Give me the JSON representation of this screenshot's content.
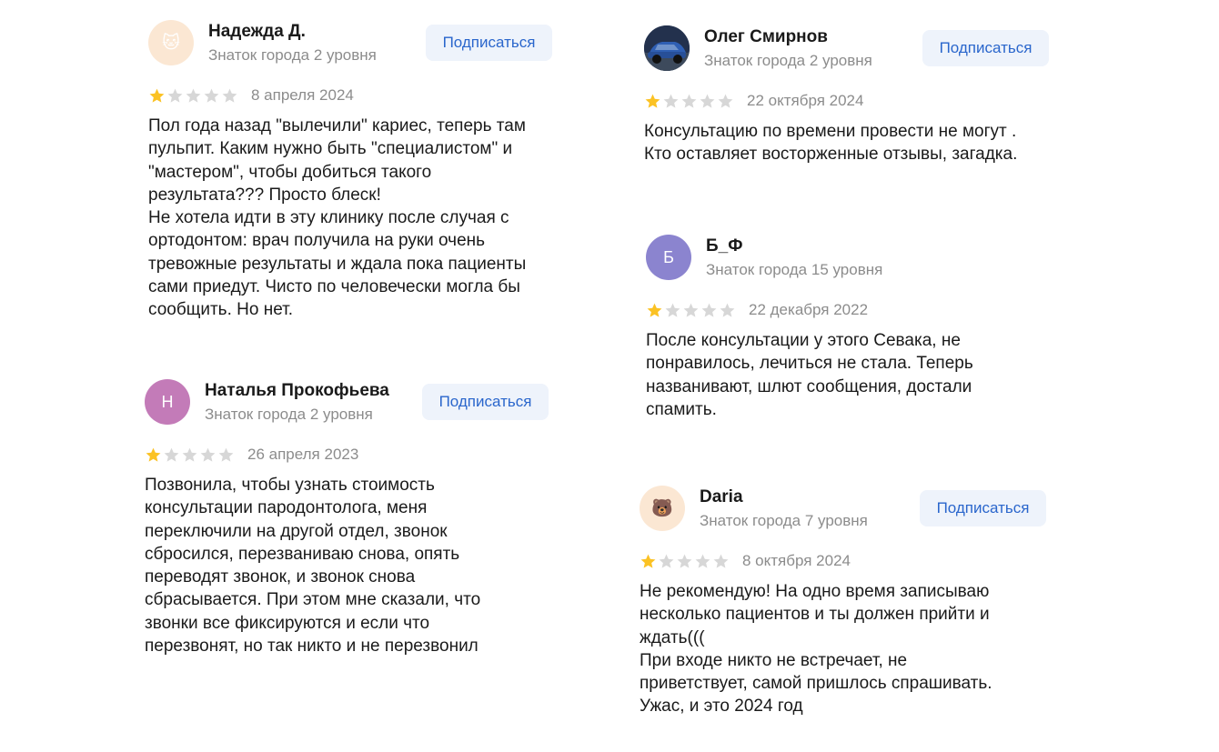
{
  "subscribe_label": "Подписаться",
  "colors": {
    "star_filled": "#fbc224",
    "star_empty": "#d7d7d7",
    "button_bg": "#eef3fb",
    "button_text": "#2a66cc"
  },
  "reviews": [
    {
      "author": "Надежда Д.",
      "level": "Знаток города 2 уровня",
      "avatar_icon": "cat-emoji-icon",
      "avatar_text": "🐱",
      "rating": 1,
      "date": "8 апреля 2024",
      "text": "Пол года назад \"вылечили\" кариес, теперь там\nпульпит. Каким нужно быть \"специалистом\" и\n\"мастером\", чтобы добиться такого\nрезультата??? Просто блеск!\nНе хотела идти в эту клинику после случая с\nортодонтом: врач получила на руки очень\nтревожные результаты и ждала пока пациенты\nсами приедут. Чисто по человечески могла бы\nсообщить. Но нет."
    },
    {
      "author": "Наталья Прокофьева",
      "level": "Знаток города 2 уровня",
      "avatar_text": "Н",
      "rating": 1,
      "date": "26 апреля 2023",
      "text": "Позвонила, чтобы узнать стоимость\nконсультации пародонтолога, меня\nпереключили на другой отдел, звонок\nсбросился, перезваниваю снова, опять\nпереводят звонок, и звонок снова\nсбрасывается. При этом мне сказали, что\nзвонки все фиксируются и если что\nперезвонят, но так никто и не перезвонил"
    },
    {
      "author": "Олег Смирнов",
      "level": "Знаток города 2 уровня",
      "avatar_icon": "car-photo-icon",
      "rating": 1,
      "date": "22 октября 2024",
      "text": "Консультацию по времени провести не могут .\nКто оставляет восторженные отзывы, загадка."
    },
    {
      "author": "Б_Ф",
      "level": "Знаток города 15 уровня",
      "avatar_text": "Б",
      "rating": 1,
      "date": "22 декабря 2022",
      "text": "После консультации у этого Севака, не\nпонравилось, лечиться не стала. Теперь\nназванивают, шлют сообщения, достали\nспамить."
    },
    {
      "author": "Daria",
      "level": "Знаток города 7 уровня",
      "avatar_icon": "bear-emoji-icon",
      "avatar_text": "🐻",
      "rating": 1,
      "date": "8 октября 2024",
      "text": "Не рекомендую! На одно время записываю\nнесколько пациентов и ты должен прийти и\nждать(((\nПри входе никто не встречает, не\nприветствует, самой пришлось спрашивать.\nУжас, и это 2024 год"
    }
  ]
}
